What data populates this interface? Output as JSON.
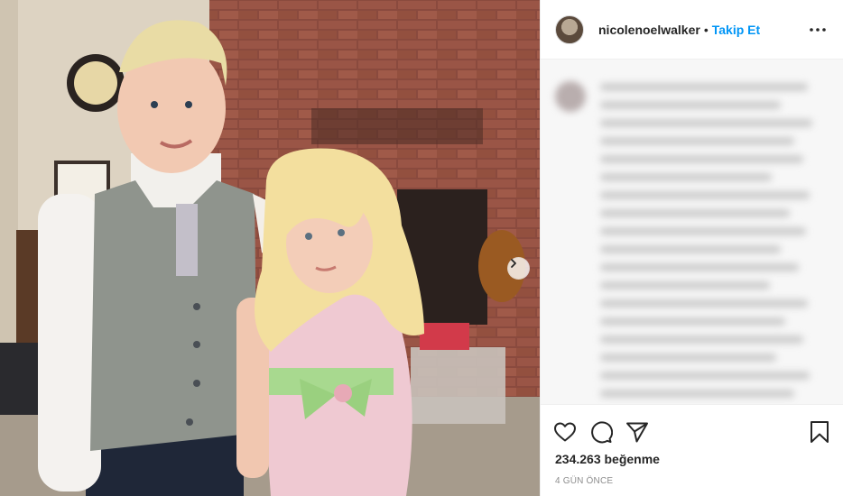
{
  "post": {
    "photo_alt": "Two children standing in front of a brick fireplace",
    "carousel_next_icon": "chevron-right-icon"
  },
  "header": {
    "username": "nicolenoelwalker",
    "separator": "•",
    "follow_label": "Takip Et",
    "more_icon": "more-horizontal-icon"
  },
  "actions": {
    "like_icon": "heart-icon",
    "comment_icon": "comment-icon",
    "share_icon": "share-icon",
    "save_icon": "bookmark-icon",
    "likes_count": "234.263",
    "likes_label": "beğenme",
    "timestamp": "4 GÜN ÖNCE"
  },
  "colors": {
    "link_blue": "#0095f6",
    "text_primary": "#262626",
    "text_secondary": "#8e8e8e"
  }
}
